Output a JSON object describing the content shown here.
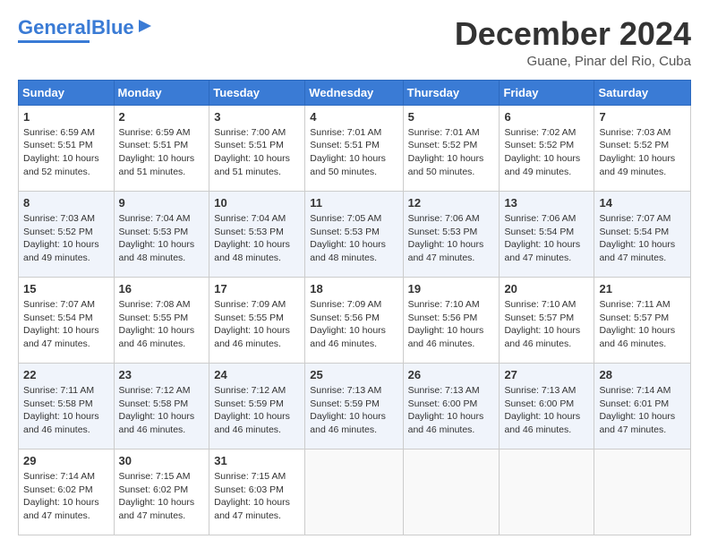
{
  "header": {
    "logo_general": "General",
    "logo_blue": "Blue",
    "month_title": "December 2024",
    "location": "Guane, Pinar del Rio, Cuba"
  },
  "days_of_week": [
    "Sunday",
    "Monday",
    "Tuesday",
    "Wednesday",
    "Thursday",
    "Friday",
    "Saturday"
  ],
  "weeks": [
    [
      {
        "day": "1",
        "sunrise": "6:59 AM",
        "sunset": "5:51 PM",
        "daylight": "10 hours and 52 minutes."
      },
      {
        "day": "2",
        "sunrise": "6:59 AM",
        "sunset": "5:51 PM",
        "daylight": "10 hours and 51 minutes."
      },
      {
        "day": "3",
        "sunrise": "7:00 AM",
        "sunset": "5:51 PM",
        "daylight": "10 hours and 51 minutes."
      },
      {
        "day": "4",
        "sunrise": "7:01 AM",
        "sunset": "5:51 PM",
        "daylight": "10 hours and 50 minutes."
      },
      {
        "day": "5",
        "sunrise": "7:01 AM",
        "sunset": "5:52 PM",
        "daylight": "10 hours and 50 minutes."
      },
      {
        "day": "6",
        "sunrise": "7:02 AM",
        "sunset": "5:52 PM",
        "daylight": "10 hours and 49 minutes."
      },
      {
        "day": "7",
        "sunrise": "7:03 AM",
        "sunset": "5:52 PM",
        "daylight": "10 hours and 49 minutes."
      }
    ],
    [
      {
        "day": "8",
        "sunrise": "7:03 AM",
        "sunset": "5:52 PM",
        "daylight": "10 hours and 49 minutes."
      },
      {
        "day": "9",
        "sunrise": "7:04 AM",
        "sunset": "5:53 PM",
        "daylight": "10 hours and 48 minutes."
      },
      {
        "day": "10",
        "sunrise": "7:04 AM",
        "sunset": "5:53 PM",
        "daylight": "10 hours and 48 minutes."
      },
      {
        "day": "11",
        "sunrise": "7:05 AM",
        "sunset": "5:53 PM",
        "daylight": "10 hours and 48 minutes."
      },
      {
        "day": "12",
        "sunrise": "7:06 AM",
        "sunset": "5:53 PM",
        "daylight": "10 hours and 47 minutes."
      },
      {
        "day": "13",
        "sunrise": "7:06 AM",
        "sunset": "5:54 PM",
        "daylight": "10 hours and 47 minutes."
      },
      {
        "day": "14",
        "sunrise": "7:07 AM",
        "sunset": "5:54 PM",
        "daylight": "10 hours and 47 minutes."
      }
    ],
    [
      {
        "day": "15",
        "sunrise": "7:07 AM",
        "sunset": "5:54 PM",
        "daylight": "10 hours and 47 minutes."
      },
      {
        "day": "16",
        "sunrise": "7:08 AM",
        "sunset": "5:55 PM",
        "daylight": "10 hours and 46 minutes."
      },
      {
        "day": "17",
        "sunrise": "7:09 AM",
        "sunset": "5:55 PM",
        "daylight": "10 hours and 46 minutes."
      },
      {
        "day": "18",
        "sunrise": "7:09 AM",
        "sunset": "5:56 PM",
        "daylight": "10 hours and 46 minutes."
      },
      {
        "day": "19",
        "sunrise": "7:10 AM",
        "sunset": "5:56 PM",
        "daylight": "10 hours and 46 minutes."
      },
      {
        "day": "20",
        "sunrise": "7:10 AM",
        "sunset": "5:57 PM",
        "daylight": "10 hours and 46 minutes."
      },
      {
        "day": "21",
        "sunrise": "7:11 AM",
        "sunset": "5:57 PM",
        "daylight": "10 hours and 46 minutes."
      }
    ],
    [
      {
        "day": "22",
        "sunrise": "7:11 AM",
        "sunset": "5:58 PM",
        "daylight": "10 hours and 46 minutes."
      },
      {
        "day": "23",
        "sunrise": "7:12 AM",
        "sunset": "5:58 PM",
        "daylight": "10 hours and 46 minutes."
      },
      {
        "day": "24",
        "sunrise": "7:12 AM",
        "sunset": "5:59 PM",
        "daylight": "10 hours and 46 minutes."
      },
      {
        "day": "25",
        "sunrise": "7:13 AM",
        "sunset": "5:59 PM",
        "daylight": "10 hours and 46 minutes."
      },
      {
        "day": "26",
        "sunrise": "7:13 AM",
        "sunset": "6:00 PM",
        "daylight": "10 hours and 46 minutes."
      },
      {
        "day": "27",
        "sunrise": "7:13 AM",
        "sunset": "6:00 PM",
        "daylight": "10 hours and 46 minutes."
      },
      {
        "day": "28",
        "sunrise": "7:14 AM",
        "sunset": "6:01 PM",
        "daylight": "10 hours and 47 minutes."
      }
    ],
    [
      {
        "day": "29",
        "sunrise": "7:14 AM",
        "sunset": "6:02 PM",
        "daylight": "10 hours and 47 minutes."
      },
      {
        "day": "30",
        "sunrise": "7:15 AM",
        "sunset": "6:02 PM",
        "daylight": "10 hours and 47 minutes."
      },
      {
        "day": "31",
        "sunrise": "7:15 AM",
        "sunset": "6:03 PM",
        "daylight": "10 hours and 47 minutes."
      },
      null,
      null,
      null,
      null
    ]
  ]
}
